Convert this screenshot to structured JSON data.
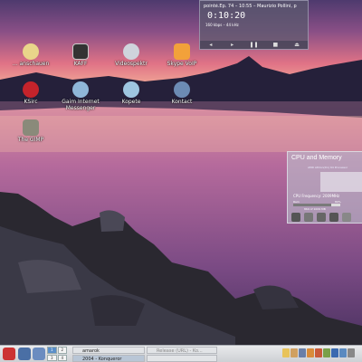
{
  "desktop": {
    "icons": [
      {
        "label": "… anschauen",
        "icon": "film-icon",
        "color": "#e9d58a"
      },
      {
        "label": "KAFF",
        "icon": "terminal-icon",
        "color": "#3a3a3a"
      },
      {
        "label": "Videospektr",
        "icon": "webcam-icon",
        "color": "#cfd4dc"
      },
      {
        "label": "Skype VoIP",
        "icon": "skype-icon",
        "color": "#f2a13a"
      },
      {
        "label": "KSirc",
        "icon": "ksirc-icon",
        "color": "#c4232b"
      },
      {
        "label": "Gaim Internet Messenger",
        "icon": "gaim-icon",
        "color": "#8fb6d8"
      },
      {
        "label": "Kopete",
        "icon": "kopete-icon",
        "color": "#9ec6e0"
      },
      {
        "label": "Kontact",
        "icon": "kontact-icon",
        "color": "#6c8bb4"
      },
      {
        "label": "The GIMP",
        "icon": "gimp-icon",
        "color": "#8a8a7a"
      }
    ]
  },
  "player": {
    "now_playing": "pointé.Ep. 74 – 10:55 – Maurizio Pollini, p",
    "time": "0:10:20",
    "bitrate": "160 kbps – 44 kHz",
    "controls": [
      "◂",
      "▸",
      "❚❚",
      "■",
      "⏏"
    ]
  },
  "cpu_widget": {
    "title": "CPU and Memory",
    "processor": "AMD Athlon(tm) 64 Processor",
    "frequency": "CPU Frequency:  2009MHz",
    "ram_label": "Ram",
    "ram_percent": "80%",
    "ram_fraction": 0.8,
    "used": "869 of 1009 MB"
  },
  "taskbar": {
    "pager": [
      "1",
      "2",
      "3",
      "4"
    ],
    "active_desktop": 0,
    "tasks": [
      {
        "label": "amarok",
        "state": "normal"
      },
      {
        "label": "Release (URL) - Ko...",
        "state": "dim"
      },
      {
        "label": "2004 - Konqueror",
        "state": "active"
      },
      {
        "label": "",
        "state": "empty"
      }
    ]
  },
  "colors": {
    "sky_top": "#5a3a72",
    "sky_glow": "#e06b7e",
    "horizon": "#f2b8a0",
    "water": "#b06a98"
  }
}
